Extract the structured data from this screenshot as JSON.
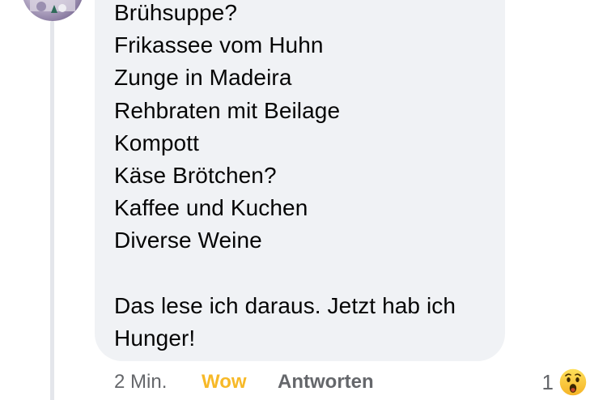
{
  "comment": {
    "lines": [
      "Brühsuppe?",
      "Frikassee vom Huhn",
      "Zunge in Madeira",
      "Rehbraten mit Beilage",
      "Kompott",
      "Käse Brötchen?",
      "Kaffee und Kuchen",
      "Diverse Weine",
      "",
      "Das lese ich daraus. Jetzt hab ich",
      "Hunger!"
    ]
  },
  "footer": {
    "time": "2 Min.",
    "reaction_label": "Wow",
    "reply_label": "Antworten"
  },
  "reactions": {
    "count": "1",
    "icon": "wow-emoji-icon",
    "accent_color": "#f7b928"
  }
}
